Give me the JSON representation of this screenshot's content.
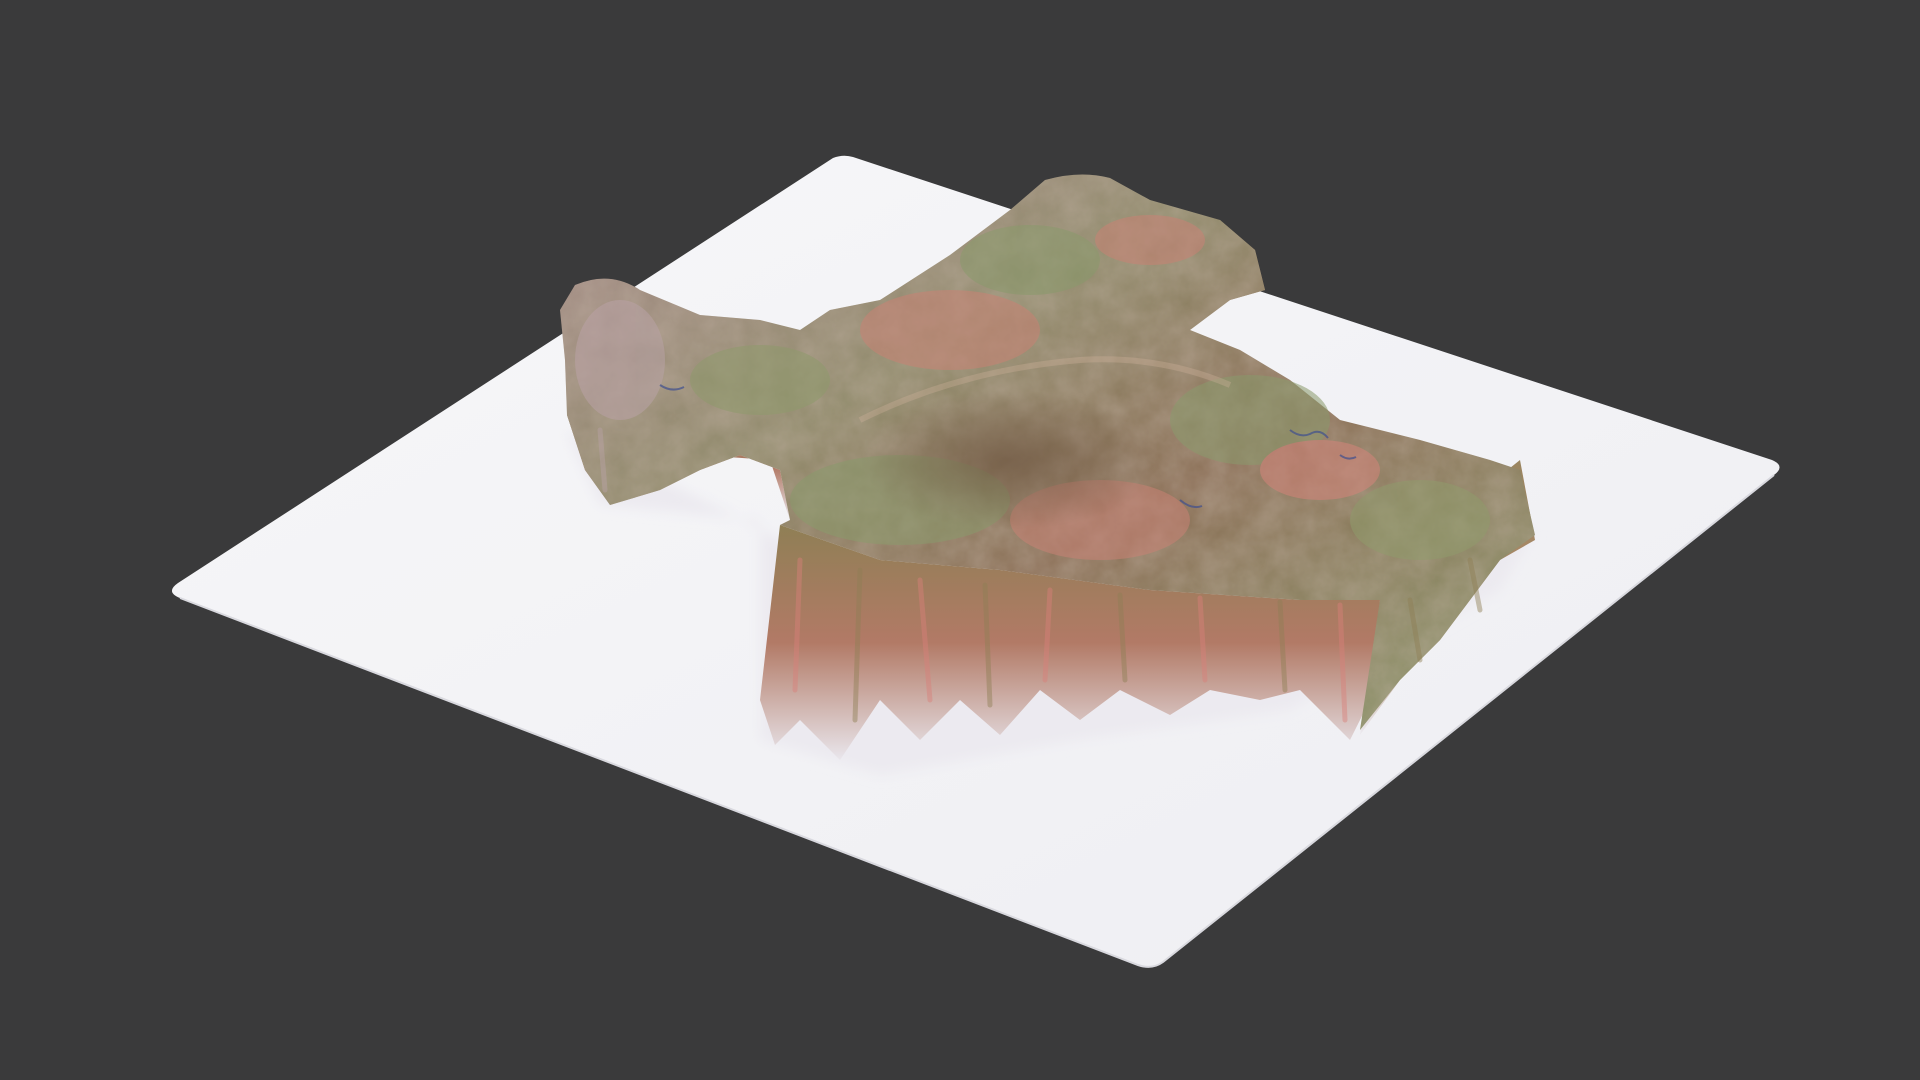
{
  "scene": {
    "kind": "3d-terrain-render",
    "colors": {
      "background": "#3a3a3b",
      "base_plate": "#f3f3f5",
      "base_plate_shadow": "#e4e4ea",
      "terrain_green": "#8a9a6c",
      "terrain_pink": "#c98274",
      "terrain_brown": "#8a6e55",
      "terrain_mauve": "#a88c8c",
      "cliff_pink": "#d9807a",
      "cliff_olive": "#8f7f55",
      "water_blue": "#3f4f8f"
    }
  }
}
